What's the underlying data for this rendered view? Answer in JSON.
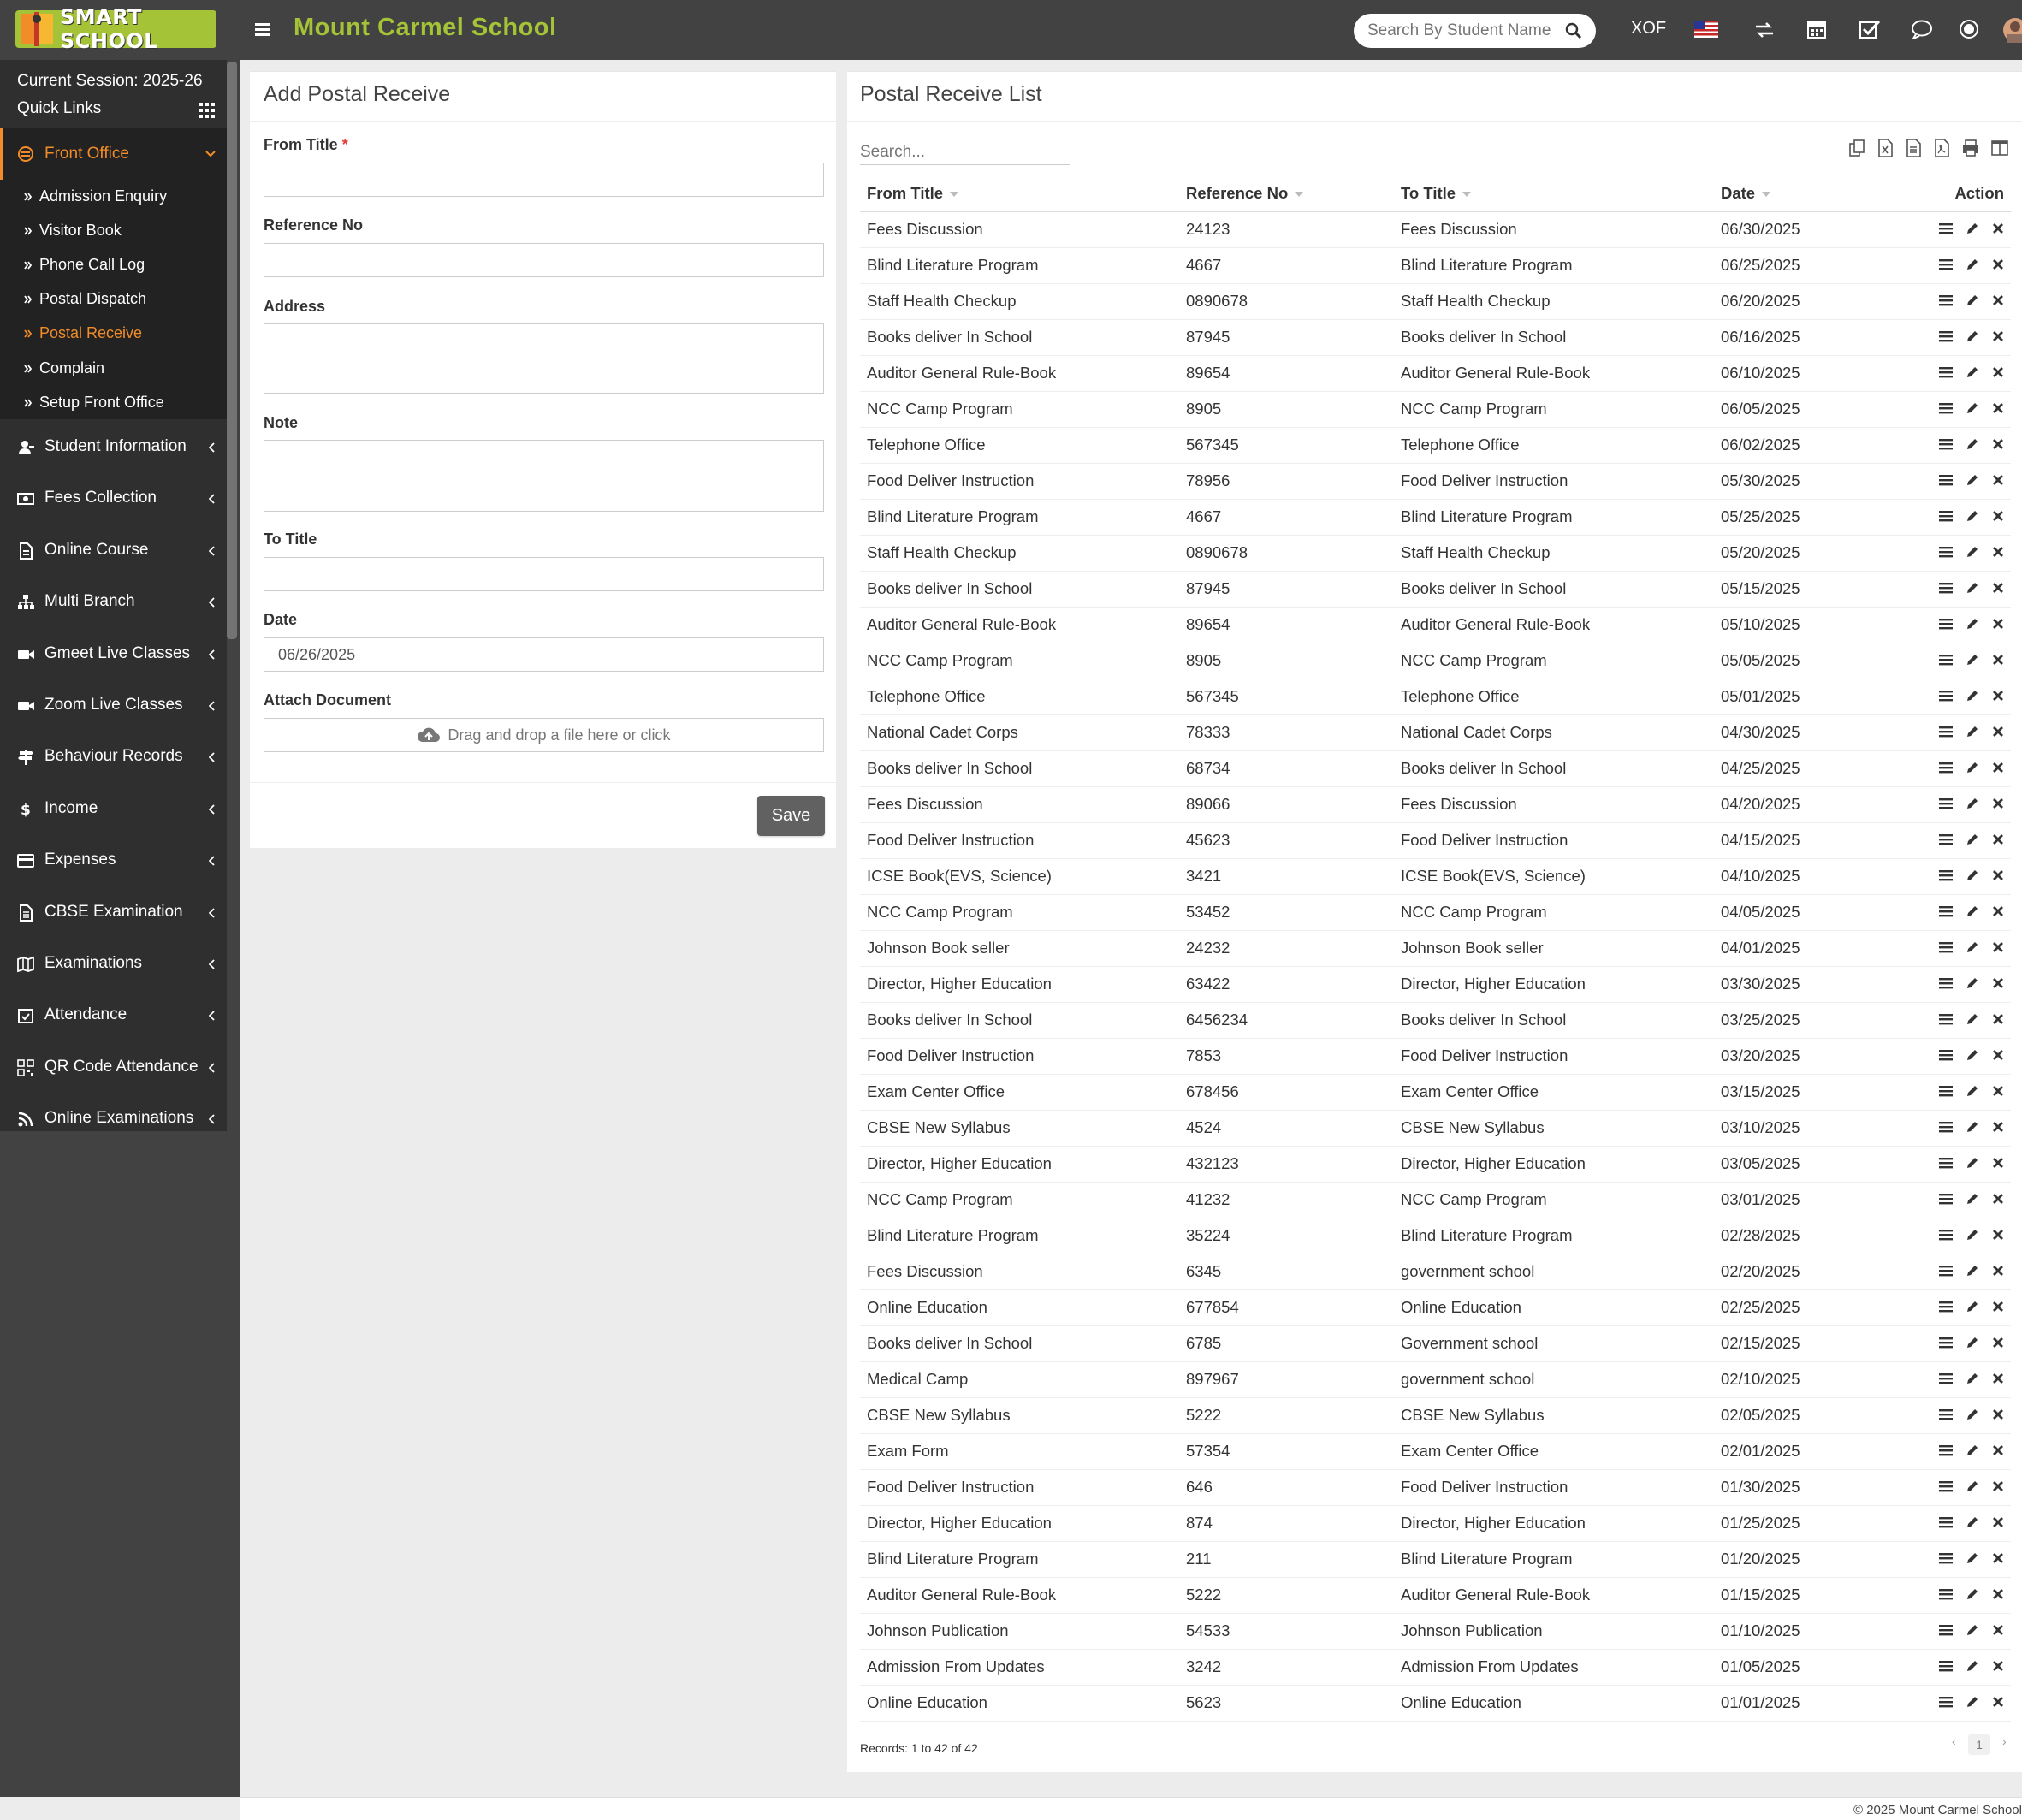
{
  "app": {
    "logo_text": "SMART SCHOOL",
    "school_name": "Mount Carmel School",
    "search_placeholder": "Search By Student Name",
    "currency": "XOF",
    "accent_color": "#a5c336",
    "active_color": "#f28c28"
  },
  "sidebar": {
    "session": "Current Session: 2025-26",
    "quick_links": "Quick Links",
    "active_menu": "Front Office",
    "submenu": [
      "Admission Enquiry",
      "Visitor Book",
      "Phone Call Log",
      "Postal Dispatch",
      "Postal Receive",
      "Complain",
      "Setup Front Office"
    ],
    "active_submenu": "Postal Receive",
    "menu": [
      {
        "label": "Student Information",
        "icon": "user-graduate-icon"
      },
      {
        "label": "Fees Collection",
        "icon": "money-icon"
      },
      {
        "label": "Online Course",
        "icon": "file-icon"
      },
      {
        "label": "Multi Branch",
        "icon": "sitemap-icon"
      },
      {
        "label": "Gmeet Live Classes",
        "icon": "video-icon"
      },
      {
        "label": "Zoom Live Classes",
        "icon": "video-icon"
      },
      {
        "label": "Behaviour Records",
        "icon": "signpost-icon"
      },
      {
        "label": "Income",
        "icon": "dollar-icon"
      },
      {
        "label": "Expenses",
        "icon": "credit-card-icon"
      },
      {
        "label": "CBSE Examination",
        "icon": "document-icon"
      },
      {
        "label": "Examinations",
        "icon": "map-icon"
      },
      {
        "label": "Attendance",
        "icon": "calendar-check-icon"
      },
      {
        "label": "QR Code Attendance",
        "icon": "qrcode-icon"
      },
      {
        "label": "Online Examinations",
        "icon": "rss-icon"
      }
    ]
  },
  "form": {
    "title": "Add Postal Receive",
    "from_title_label": "From Title",
    "required_mark": "*",
    "reference_label": "Reference No",
    "address_label": "Address",
    "note_label": "Note",
    "to_title_label": "To Title",
    "date_label": "Date",
    "date_value": "06/26/2025",
    "attach_label": "Attach Document",
    "attach_placeholder": "Drag and drop a file here or click",
    "save_label": "Save"
  },
  "list": {
    "title": "Postal Receive List",
    "search_placeholder": "Search...",
    "columns": [
      "From Title",
      "Reference No",
      "To Title",
      "Date",
      "Action"
    ],
    "rows": [
      [
        "Fees Discussion",
        "24123",
        "Fees Discussion",
        "06/30/2025"
      ],
      [
        "Blind Literature Program",
        "4667",
        "Blind Literature Program",
        "06/25/2025"
      ],
      [
        "Staff Health Checkup",
        "0890678",
        "Staff Health Checkup",
        "06/20/2025"
      ],
      [
        "Books deliver In School",
        "87945",
        "Books deliver In School",
        "06/16/2025"
      ],
      [
        "Auditor General Rule-Book",
        "89654",
        "Auditor General Rule-Book",
        "06/10/2025"
      ],
      [
        "NCC Camp Program",
        "8905",
        "NCC Camp Program",
        "06/05/2025"
      ],
      [
        "Telephone Office",
        "567345",
        "Telephone Office",
        "06/02/2025"
      ],
      [
        "Food Deliver Instruction",
        "78956",
        "Food Deliver Instruction",
        "05/30/2025"
      ],
      [
        "Blind Literature Program",
        "4667",
        "Blind Literature Program",
        "05/25/2025"
      ],
      [
        "Staff Health Checkup",
        "0890678",
        "Staff Health Checkup",
        "05/20/2025"
      ],
      [
        "Books deliver In School",
        "87945",
        "Books deliver In School",
        "05/15/2025"
      ],
      [
        "Auditor General Rule-Book",
        "89654",
        "Auditor General Rule-Book",
        "05/10/2025"
      ],
      [
        "NCC Camp Program",
        "8905",
        "NCC Camp Program",
        "05/05/2025"
      ],
      [
        "Telephone Office",
        "567345",
        "Telephone Office",
        "05/01/2025"
      ],
      [
        "National Cadet Corps",
        "78333",
        "National Cadet Corps",
        "04/30/2025"
      ],
      [
        "Books deliver In School",
        "68734",
        "Books deliver In School",
        "04/25/2025"
      ],
      [
        "Fees Discussion",
        "89066",
        "Fees Discussion",
        "04/20/2025"
      ],
      [
        "Food Deliver Instruction",
        "45623",
        "Food Deliver Instruction",
        "04/15/2025"
      ],
      [
        "ICSE Book(EVS, Science)",
        "3421",
        "ICSE Book(EVS, Science)",
        "04/10/2025"
      ],
      [
        "NCC Camp Program",
        "53452",
        "NCC Camp Program",
        "04/05/2025"
      ],
      [
        "Johnson Book seller",
        "24232",
        "Johnson Book seller",
        "04/01/2025"
      ],
      [
        "Director, Higher Education",
        "63422",
        "Director, Higher Education",
        "03/30/2025"
      ],
      [
        "Books deliver In School",
        "6456234",
        "Books deliver In School",
        "03/25/2025"
      ],
      [
        "Food Deliver Instruction",
        "7853",
        "Food Deliver Instruction",
        "03/20/2025"
      ],
      [
        "Exam Center Office",
        "678456",
        "Exam Center Office",
        "03/15/2025"
      ],
      [
        "CBSE New Syllabus",
        "4524",
        "CBSE New Syllabus",
        "03/10/2025"
      ],
      [
        "Director, Higher Education",
        "432123",
        "Director, Higher Education",
        "03/05/2025"
      ],
      [
        "NCC Camp Program",
        "41232",
        "NCC Camp Program",
        "03/01/2025"
      ],
      [
        "Blind Literature Program",
        "35224",
        "Blind Literature Program",
        "02/28/2025"
      ],
      [
        "Fees Discussion",
        "6345",
        "government school",
        "02/20/2025"
      ],
      [
        "Online Education",
        "677854",
        "Online Education",
        "02/25/2025"
      ],
      [
        "Books deliver In School",
        "6785",
        "Government school",
        "02/15/2025"
      ],
      [
        "Medical Camp",
        "897967",
        "government school",
        "02/10/2025"
      ],
      [
        "CBSE New Syllabus",
        "5222",
        "CBSE New Syllabus",
        "02/05/2025"
      ],
      [
        "Exam Form",
        "57354",
        "Exam Center Office",
        "02/01/2025"
      ],
      [
        "Food Deliver Instruction",
        "646",
        "Food Deliver Instruction",
        "01/30/2025"
      ],
      [
        "Director, Higher Education",
        "874",
        "Director, Higher Education",
        "01/25/2025"
      ],
      [
        "Blind Literature Program",
        "211",
        "Blind Literature Program",
        "01/20/2025"
      ],
      [
        "Auditor General Rule-Book",
        "5222",
        "Auditor General Rule-Book",
        "01/15/2025"
      ],
      [
        "Johnson Publication",
        "54533",
        "Johnson Publication",
        "01/10/2025"
      ],
      [
        "Admission From Updates",
        "3242",
        "Admission From Updates",
        "01/05/2025"
      ],
      [
        "Online Education",
        "5623",
        "Online Education",
        "01/01/2025"
      ]
    ],
    "records_text": "Records: 1 to 42 of 42",
    "page": "1"
  },
  "footer": {
    "copyright": "© 2025 Mount Carmel School"
  }
}
